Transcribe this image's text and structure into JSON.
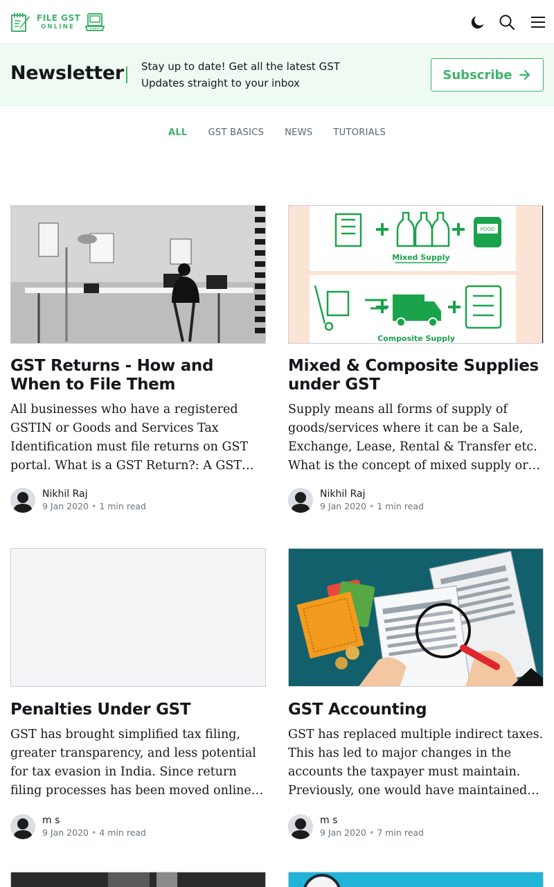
{
  "header": {
    "logo_line1": "FILE GST",
    "logo_line2": "ONLINE",
    "icons": [
      "moon-icon",
      "search-icon",
      "menu-icon"
    ]
  },
  "newsletter": {
    "title": "Newsletter",
    "description": "Stay up to date! Get all the latest GST Updates straight to your inbox",
    "button_label": "Subscribe"
  },
  "tabs": [
    {
      "label": "ALL",
      "active": true
    },
    {
      "label": "GST BASICS",
      "active": false
    },
    {
      "label": "NEWS",
      "active": false
    },
    {
      "label": "TUTORIALS",
      "active": false
    }
  ],
  "posts": [
    {
      "title": "GST Returns - How and When to File Them",
      "excerpt": "All businesses who have a registered GSTIN or Goods and Services Tax Identification must file returns on GST portal. What is a GST Return?: A GST return is a document containing details of income.",
      "author": "Nikhil Raj",
      "date": "9 Jan 2020",
      "read_time": "1 min read",
      "image": "office-photo"
    },
    {
      "title": "Mixed & Composite Supplies under GST",
      "excerpt": "Supply means all forms of supply of goods/services where it can be a Sale, Exchange, Lease, Rental & Transfer etc. What is the concept of mixed supply or composite supply under GST?",
      "author": "Nikhil Raj",
      "date": "9 Jan 2020",
      "read_time": "1 min read",
      "image": "supply-illustration",
      "image_text": {
        "food_label": "FOOD",
        "mixed_label": "Mixed Supply",
        "composite_label": "Composite Supply"
      }
    },
    {
      "title": "Penalties Under GST",
      "excerpt": "GST has brought simplified tax filing, greater transparency, and less potential for tax evasion in India. Since return filing processes has been moved online, penalties are also levied.",
      "author": "m s",
      "date": "9 Jan 2020",
      "read_time": "4 min read",
      "image": "placeholder"
    },
    {
      "title": "GST Accounting",
      "excerpt": "GST has replaced multiple indirect taxes. This has led to major changes in the accounts the taxpayer must maintain. Previously, one would have maintained separate accounts for each tax.",
      "author": "m s",
      "date": "9 Jan 2020",
      "read_time": "7 min read",
      "image": "accounting-illustration"
    }
  ],
  "colors": {
    "accent": "#3eb36b",
    "newsletter_bg": "#eefaf2",
    "text": "#15171a",
    "muted": "#6b7380"
  }
}
